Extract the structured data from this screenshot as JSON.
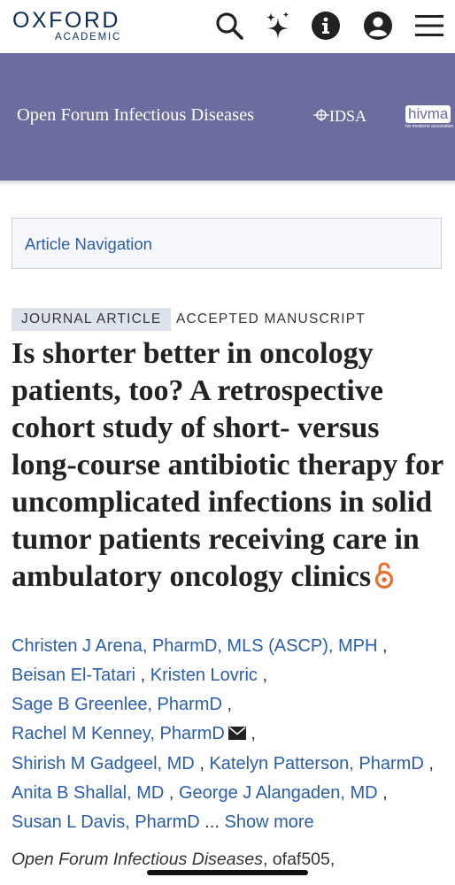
{
  "header": {
    "logo_main": "OXFORD",
    "logo_sub": "ACADEMIC",
    "icons": [
      "search-icon",
      "sparkle-icon",
      "info-icon",
      "account-icon",
      "menu-icon"
    ]
  },
  "banner": {
    "journal_name": "Open Forum Infectious Diseases",
    "idsa": "IDSA",
    "hivma": "hivma",
    "hivma_sub": "hiv medicine association",
    "background": "#6a6d9e"
  },
  "article_nav": {
    "label": "Article Navigation"
  },
  "badges": {
    "type": "JOURNAL ARTICLE",
    "status": "ACCEPTED MANUSCRIPT"
  },
  "title": "Is shorter better in oncology patients, too? A retrospective cohort study of short- versus long-course antibiotic therapy for uncomplicated infections in solid tumor patients receiving care in ambulatory oncology clinics",
  "authors": [
    "Christen J Arena, PharmD, MLS (ASCP), MPH",
    "Beisan El-Tatari",
    "Kristen Lovric",
    "Sage B Greenlee, PharmD",
    "Rachel M Kenney, PharmD",
    "Shirish M Gadgeel, MD",
    "Katelyn Patterson, PharmD",
    "Anita B Shallal, MD",
    "George J Alangaden, MD",
    "Susan L Davis, PharmD"
  ],
  "separator": ",",
  "ellipsis": "...",
  "show_more": "Show more",
  "citation": {
    "journal": "Open Forum Infectious Diseases",
    "article_id": ", ofaf505,"
  },
  "colors": {
    "link": "#2a5db0",
    "oa_icon": "#e8702a",
    "logo": "#0e2e5a"
  }
}
